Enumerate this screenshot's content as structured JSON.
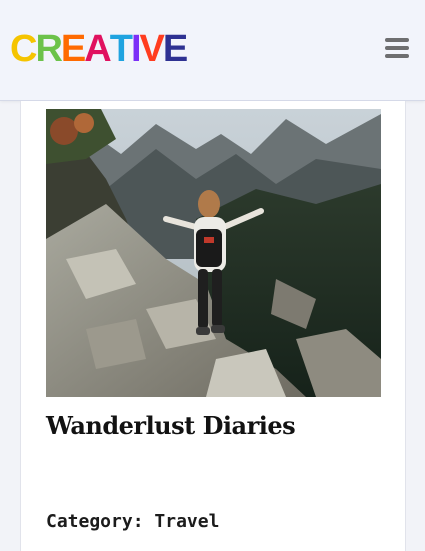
{
  "header": {
    "logo_text": "CREATIVE",
    "logo_colors": [
      "#f5c400",
      "#6cc24a",
      "#ff6a00",
      "#e0115f",
      "#1fa3e0",
      "#7b2ff7",
      "#ff3c1f",
      "#2e3192"
    ],
    "menu_icon": "hamburger-menu-icon"
  },
  "post": {
    "image_alt": "Hiker with backpack walking down a rocky mountain trail",
    "title": "Wanderlust Diaries",
    "category_label": "Category:",
    "category_value": "Travel"
  }
}
